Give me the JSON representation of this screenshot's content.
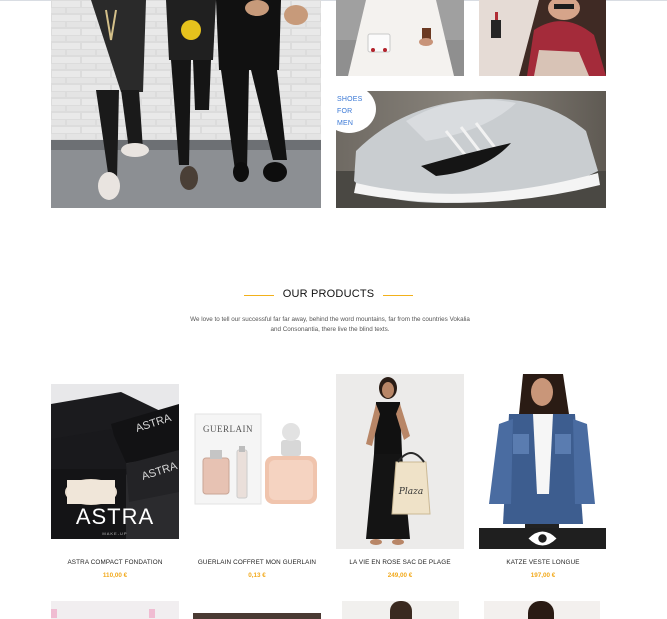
{
  "banner": {
    "shoes_label_lines": [
      "SHOES",
      "FOR",
      "MEN"
    ]
  },
  "section": {
    "title": "OUR PRODUCTS",
    "description": "We love to tell our successful far far away, behind the word mountains, far from the countries Vokalia and Consonantia, there live the blind texts."
  },
  "products": [
    {
      "name": "ASTRA COMPACT FONDATION",
      "price": "110,00 €"
    },
    {
      "name": "GUERLAIN COFFRET MON GUERLAIN",
      "price": "0,13 €"
    },
    {
      "name": "LA VIE EN ROSE SAC DE PLAGE",
      "price": "249,00 €"
    },
    {
      "name": "KATZE VESTE LONGUE",
      "price": "197,00 €"
    }
  ],
  "product_images": {
    "astra_brand": "ASTRA",
    "astra_sub": "MAKE-UP",
    "guerlain_brand": "GUERLAIN",
    "bag_text": "Plaza"
  },
  "peek_tags": [
    "",
    ""
  ],
  "colors": {
    "accent": "#f2b11b",
    "price": "#f2a91b",
    "badge_text": "#3a78d6"
  },
  "icons": [
    "eye-icon"
  ]
}
